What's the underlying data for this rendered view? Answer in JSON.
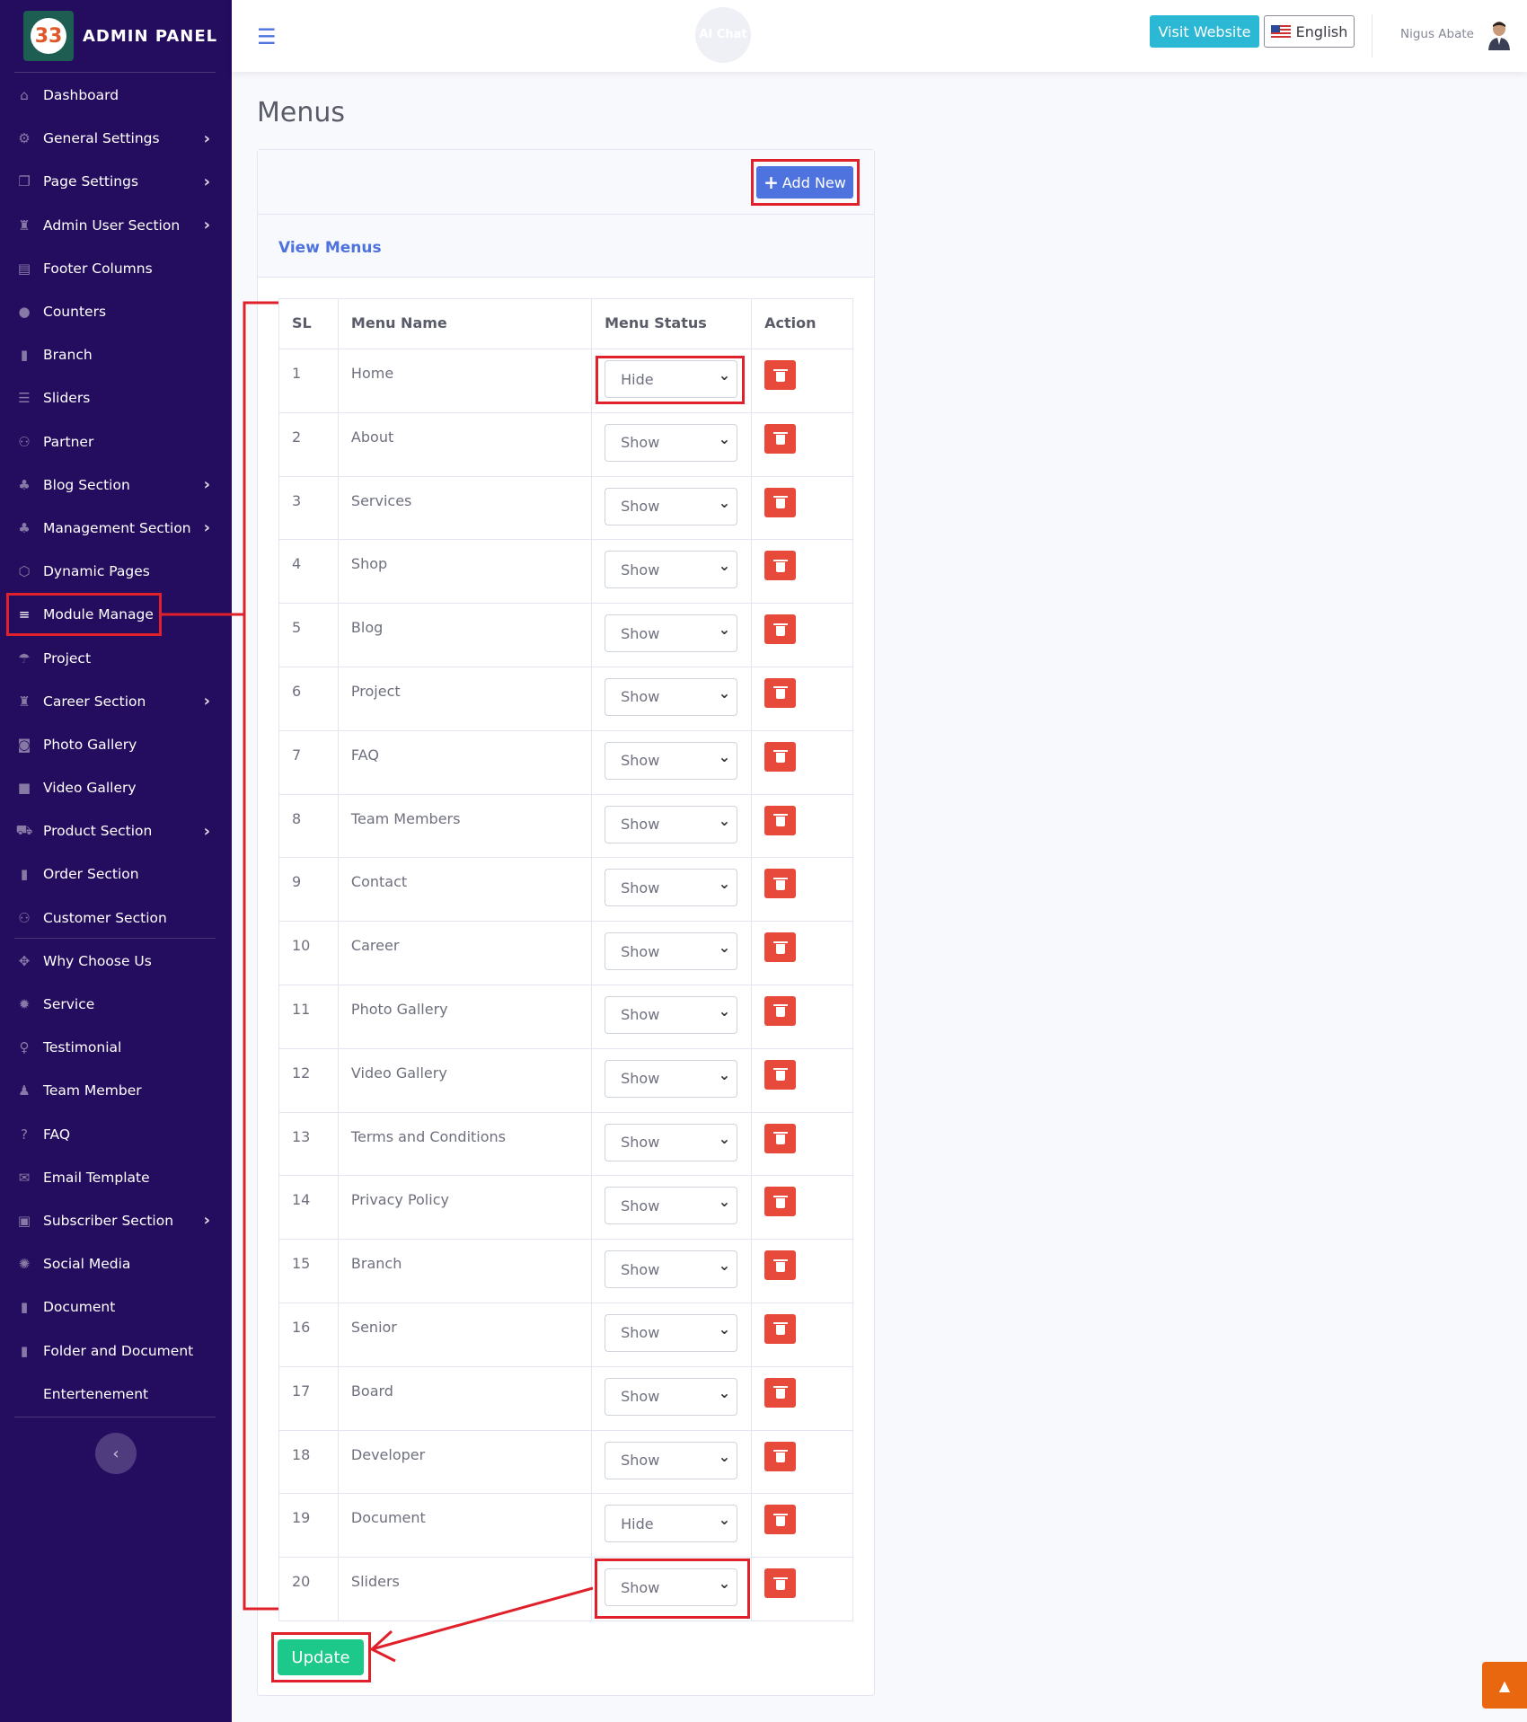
{
  "brand": {
    "title": "ADMIN PANEL",
    "logo_text": "33"
  },
  "sidebar": {
    "items": [
      {
        "label": "Dashboard",
        "icon": "home-icon",
        "glyph": "⌂",
        "chevron": false
      },
      {
        "label": "General Settings",
        "icon": "cog-icon",
        "glyph": "⚙",
        "chevron": true
      },
      {
        "label": "Page Settings",
        "icon": "copy-icon",
        "glyph": "❐",
        "chevron": true
      },
      {
        "label": "Admin User Section",
        "icon": "user-lock-icon",
        "glyph": "♜",
        "chevron": true
      },
      {
        "label": "Footer Columns",
        "icon": "columns-icon",
        "glyph": "▤",
        "chevron": false
      },
      {
        "label": "Counters",
        "icon": "comment-icon",
        "glyph": "●",
        "chevron": false
      },
      {
        "label": "Branch",
        "icon": "building-icon",
        "glyph": "▮",
        "chevron": false
      },
      {
        "label": "Sliders",
        "icon": "sliders-icon",
        "glyph": "☰",
        "chevron": false
      },
      {
        "label": "Partner",
        "icon": "users-icon",
        "glyph": "⚇",
        "chevron": false
      },
      {
        "label": "Blog Section",
        "icon": "blog-icon",
        "glyph": "♣",
        "chevron": true
      },
      {
        "label": "Management Section",
        "icon": "people-icon",
        "glyph": "♣",
        "chevron": true
      },
      {
        "label": "Dynamic Pages",
        "icon": "cube-icon",
        "glyph": "⬡",
        "chevron": false
      },
      {
        "label": "Module Manage",
        "icon": "bars-icon",
        "glyph": "≡",
        "chevron": false
      },
      {
        "label": "Project",
        "icon": "umbrella-icon",
        "glyph": "☂",
        "chevron": false
      },
      {
        "label": "Career Section",
        "icon": "briefcase-icon",
        "glyph": "♜",
        "chevron": true
      },
      {
        "label": "Photo Gallery",
        "icon": "camera-icon",
        "glyph": "◙",
        "chevron": false
      },
      {
        "label": "Video Gallery",
        "icon": "video-icon",
        "glyph": "■",
        "chevron": false
      },
      {
        "label": "Product Section",
        "icon": "cart-icon",
        "glyph": "⛟",
        "chevron": true
      },
      {
        "label": "Order Section",
        "icon": "bookmark-icon",
        "glyph": "▮",
        "chevron": false
      },
      {
        "label": "Customer Section",
        "icon": "customers-icon",
        "glyph": "⚇",
        "chevron": false
      },
      {
        "label": "Why Choose Us",
        "icon": "arrows-icon",
        "glyph": "✥",
        "chevron": false
      },
      {
        "label": "Service",
        "icon": "gear-icon",
        "glyph": "✹",
        "chevron": false
      },
      {
        "label": "Testimonial",
        "icon": "award-icon",
        "glyph": "♀",
        "chevron": false
      },
      {
        "label": "Team Member",
        "icon": "user-plus-icon",
        "glyph": "♟",
        "chevron": false
      },
      {
        "label": "FAQ",
        "icon": "question-icon",
        "glyph": "?",
        "chevron": false
      },
      {
        "label": "Email Template",
        "icon": "envelope-icon",
        "glyph": "✉",
        "chevron": false
      },
      {
        "label": "Subscriber Section",
        "icon": "subscriber-icon",
        "glyph": "▣",
        "chevron": true
      },
      {
        "label": "Social Media",
        "icon": "globe-icon",
        "glyph": "✺",
        "chevron": false
      },
      {
        "label": "Document",
        "icon": "book-icon",
        "glyph": "▮",
        "chevron": false
      },
      {
        "label": "Folder and Document",
        "icon": "folder-icon",
        "glyph": "▮",
        "chevron": false
      },
      {
        "label": "Entertenement",
        "icon": "",
        "glyph": "",
        "chevron": false
      }
    ],
    "active": "Module Manage"
  },
  "topbar": {
    "menu_icon": "bars-icon",
    "ai_chat_label": "AI Chat",
    "visit_website": "Visit Website",
    "language": "English",
    "user_name": "Nigus Abate"
  },
  "page": {
    "title": "Menus",
    "add_new_label": "Add New",
    "card_title": "View Menus",
    "update_label": "Update"
  },
  "table": {
    "headers": [
      "SL",
      "Menu Name",
      "Menu Status",
      "Action"
    ],
    "rows": [
      {
        "sl": "1",
        "name": "Home",
        "status": "Hide"
      },
      {
        "sl": "2",
        "name": "About",
        "status": "Show"
      },
      {
        "sl": "3",
        "name": "Services",
        "status": "Show"
      },
      {
        "sl": "4",
        "name": "Shop",
        "status": "Show"
      },
      {
        "sl": "5",
        "name": "Blog",
        "status": "Show"
      },
      {
        "sl": "6",
        "name": "Project",
        "status": "Show"
      },
      {
        "sl": "7",
        "name": "FAQ",
        "status": "Show"
      },
      {
        "sl": "8",
        "name": "Team Members",
        "status": "Show"
      },
      {
        "sl": "9",
        "name": "Contact",
        "status": "Show"
      },
      {
        "sl": "10",
        "name": "Career",
        "status": "Show"
      },
      {
        "sl": "11",
        "name": "Photo Gallery",
        "status": "Show"
      },
      {
        "sl": "12",
        "name": "Video Gallery",
        "status": "Show"
      },
      {
        "sl": "13",
        "name": "Terms and Conditions",
        "status": "Show"
      },
      {
        "sl": "14",
        "name": "Privacy Policy",
        "status": "Show"
      },
      {
        "sl": "15",
        "name": "Branch",
        "status": "Show"
      },
      {
        "sl": "16",
        "name": "Senior",
        "status": "Show"
      },
      {
        "sl": "17",
        "name": "Board",
        "status": "Show"
      },
      {
        "sl": "18",
        "name": "Developer",
        "status": "Show"
      },
      {
        "sl": "19",
        "name": "Document",
        "status": "Hide"
      },
      {
        "sl": "20",
        "name": "Sliders",
        "status": "Show"
      }
    ]
  },
  "colors": {
    "sidebar_bg": "#240c5e",
    "primary": "#4e73df",
    "danger": "#e74a3b",
    "success": "#1cc88a",
    "info": "#2bb8d4",
    "annotation": "#e0202a",
    "scroll_top": "#e8670f"
  }
}
